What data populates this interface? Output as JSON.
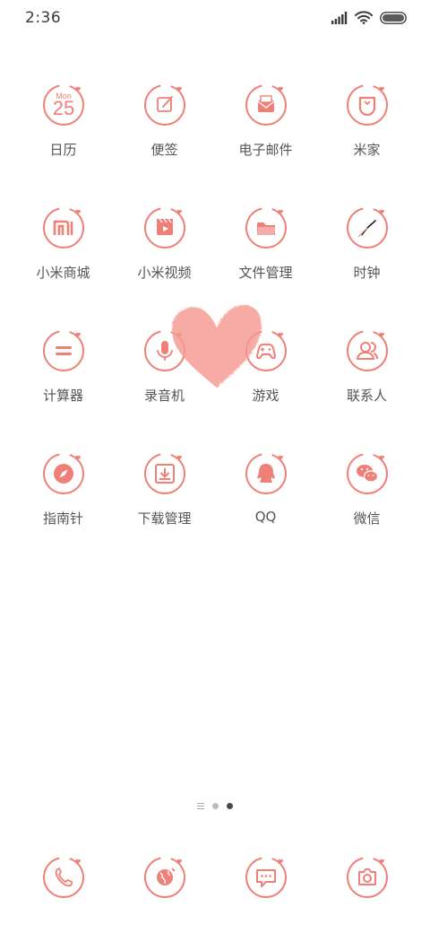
{
  "status_bar": {
    "time": "2:36",
    "icons": [
      "signal-icon",
      "wifi-icon",
      "battery-icon"
    ]
  },
  "theme": {
    "accent": "#ef8078",
    "label_color": "#555555"
  },
  "apps": [
    {
      "label": "日历",
      "icon": "calendar-icon",
      "calendar_month": "Mon",
      "calendar_day": "25"
    },
    {
      "label": "便签",
      "icon": "notes-icon"
    },
    {
      "label": "电子邮件",
      "icon": "email-icon"
    },
    {
      "label": "米家",
      "icon": "mijia-icon"
    },
    {
      "label": "小米商城",
      "icon": "mi-store-icon"
    },
    {
      "label": "小米视频",
      "icon": "video-icon"
    },
    {
      "label": "文件管理",
      "icon": "folder-icon"
    },
    {
      "label": "时钟",
      "icon": "clock-icon"
    },
    {
      "label": "计算器",
      "icon": "calculator-icon"
    },
    {
      "label": "录音机",
      "icon": "microphone-icon"
    },
    {
      "label": "游戏",
      "icon": "gamepad-icon"
    },
    {
      "label": "联系人",
      "icon": "contacts-icon"
    },
    {
      "label": "指南针",
      "icon": "compass-icon"
    },
    {
      "label": "下载管理",
      "icon": "download-icon"
    },
    {
      "label": "QQ",
      "icon": "qq-icon"
    },
    {
      "label": "微信",
      "icon": "wechat-icon"
    }
  ],
  "page_indicator": {
    "pages": 2,
    "current": 2
  },
  "dock": [
    {
      "icon": "phone-icon"
    },
    {
      "icon": "browser-icon"
    },
    {
      "icon": "messages-icon"
    },
    {
      "icon": "camera-icon"
    }
  ]
}
